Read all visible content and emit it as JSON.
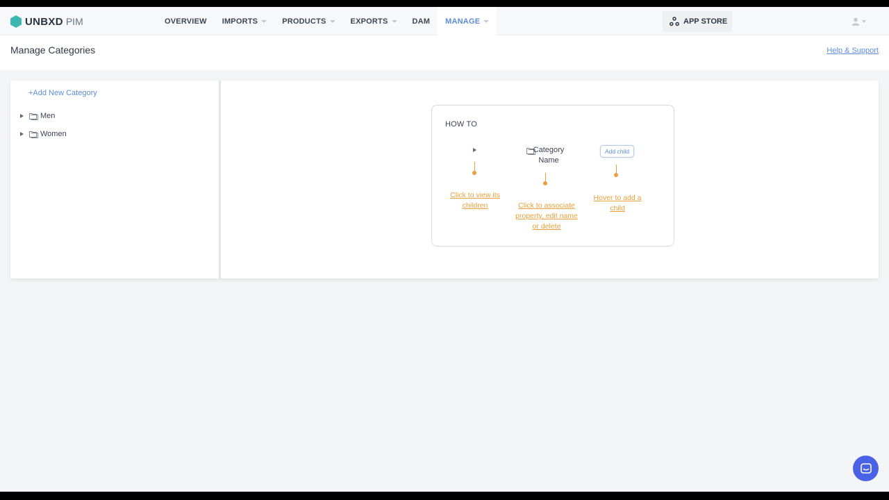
{
  "brand": {
    "name": "UNBXD",
    "product": "PIM",
    "accent": "#3cb8b0"
  },
  "nav": {
    "items": [
      {
        "label": "OVERVIEW",
        "dropdown": false,
        "active": false
      },
      {
        "label": "IMPORTS",
        "dropdown": true,
        "active": false
      },
      {
        "label": "PRODUCTS",
        "dropdown": true,
        "active": false
      },
      {
        "label": "EXPORTS",
        "dropdown": true,
        "active": false
      },
      {
        "label": "DAM",
        "dropdown": false,
        "active": false
      },
      {
        "label": "MANAGE",
        "dropdown": true,
        "active": true
      }
    ],
    "app_store": "APP STORE"
  },
  "page": {
    "title": "Manage Categories",
    "help_link": "Help & Support"
  },
  "sidebar": {
    "add_category": "+Add New Category",
    "categories": [
      {
        "label": "Men"
      },
      {
        "label": "Women"
      }
    ]
  },
  "howto": {
    "title": "HOW TO",
    "category_name": "Category Name",
    "add_child_button": "Add child",
    "hint_view_children": "Click to view its children",
    "hint_associate": "Click to associate property, edit name or delete",
    "hint_add_child": "Hover to add a child"
  },
  "colors": {
    "link_blue": "#5b8dd6",
    "hint_orange": "#e8a03a",
    "chat_blue": "#4a63e6"
  }
}
